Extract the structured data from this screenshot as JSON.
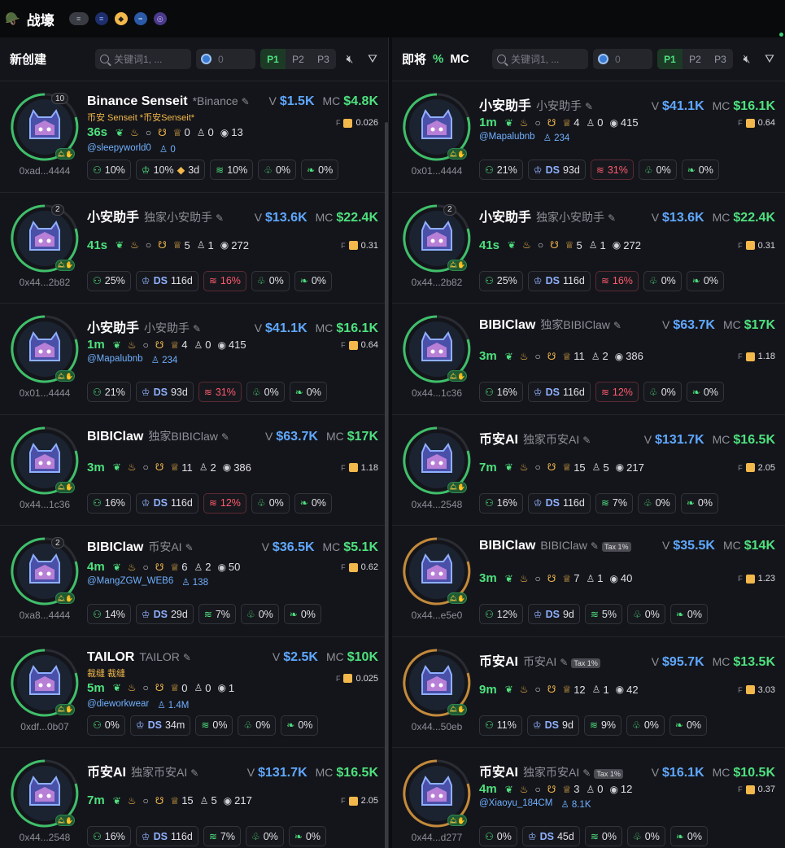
{
  "app": {
    "title": "战壕",
    "logo": "helmet-icon"
  },
  "colors": {
    "accent": "#4ee17f",
    "blue": "#5fa8ff",
    "red": "#ff5b6e",
    "gold": "#f2b84b"
  },
  "left": {
    "title": "新创建",
    "search_placeholder": "关键词1, ...",
    "amount": "0",
    "tabs": [
      "P1",
      "P2",
      "P3"
    ],
    "active_tab": "P1",
    "cards": [
      {
        "name": "Binance Senseit",
        "sub": "*Binance",
        "cn": "币安 Senseit *币安Senseit*",
        "v": "$1.5K",
        "mc": "$4.8K",
        "age": "36s",
        "s1": "0",
        "s2": "0",
        "s3": "13",
        "f": "0.026",
        "handle": "@sleepyworld0",
        "followers": "0",
        "addr": "0xad...4444",
        "cnt": "10",
        "c1": "10%",
        "c2": "10%",
        "c2b": "3d",
        "c3": "10%",
        "c4": "0%",
        "c5": "0%"
      },
      {
        "name": "小安助手",
        "sub": "独家小安助手",
        "v": "$13.6K",
        "mc": "$22.4K",
        "age": "41s",
        "s1": "5",
        "s2": "1",
        "s3": "272",
        "f": "0.31",
        "addr": "0x44...2b82",
        "cnt": "2",
        "c1": "25%",
        "c2": "116d",
        "c3": "16%",
        "c4": "0%",
        "c5": "0%"
      },
      {
        "name": "小安助手",
        "sub": "小安助手",
        "v": "$41.1K",
        "mc": "$16.1K",
        "age": "1m",
        "s1": "4",
        "s2": "0",
        "s3": "415",
        "f": "0.64",
        "handle": "@Mapalubnb",
        "followers": "234",
        "addr": "0x01...4444",
        "c1": "21%",
        "c2": "93d",
        "c3": "31%",
        "c4": "0%",
        "c5": "0%"
      },
      {
        "name": "BIBIClaw",
        "sub": "独家BIBIClaw",
        "v": "$63.7K",
        "mc": "$17K",
        "age": "3m",
        "s1": "11",
        "s2": "2",
        "s3": "386",
        "f": "1.18",
        "addr": "0x44...1c36",
        "c1": "16%",
        "c2": "116d",
        "c3": "12%",
        "c4": "0%",
        "c5": "0%"
      },
      {
        "name": "BIBIClaw",
        "sub": "币安AI",
        "v": "$36.5K",
        "mc": "$5.1K",
        "age": "4m",
        "s1": "6",
        "s2": "2",
        "s3": "50",
        "f": "0.62",
        "handle": "@MangZGW_WEB6",
        "followers": "138",
        "addr": "0xa8...4444",
        "cnt": "2",
        "c1": "14%",
        "c2": "29d",
        "c3": "7%",
        "c4": "0%",
        "c5": "0%"
      },
      {
        "name": "TAILOR",
        "sub": "TAILOR",
        "cn": "裁缝 裁缝",
        "v": "$2.5K",
        "mc": "$10K",
        "age": "5m",
        "s1": "0",
        "s2": "0",
        "s3": "1",
        "f": "0.025",
        "handle": "@dieworkwear",
        "followers": "1.4M",
        "addr": "0xdf...0b07",
        "c1": "0%",
        "c2": "34m",
        "c3": "0%",
        "c4": "0%",
        "c5": "0%"
      },
      {
        "name": "币安AI",
        "sub": "独家币安AI",
        "v": "$131.7K",
        "mc": "$16.5K",
        "age": "7m",
        "s1": "15",
        "s2": "5",
        "s3": "217",
        "f": "2.05",
        "addr": "0x44...2548",
        "c1": "16%",
        "c2": "116d",
        "c3": "7%",
        "c4": "0%",
        "c5": "0%"
      }
    ]
  },
  "right": {
    "title": "即将",
    "pct": "%",
    "mc": "MC",
    "search_placeholder": "关键词1, ...",
    "amount": "0",
    "tabs": [
      "P1",
      "P2",
      "P3"
    ],
    "active_tab": "P1",
    "cards": [
      {
        "name": "小安助手",
        "sub": "小安助手",
        "v": "$41.1K",
        "mc": "$16.1K",
        "age": "1m",
        "s1": "4",
        "s2": "0",
        "s3": "415",
        "f": "0.64",
        "handle": "@Mapalubnb",
        "followers": "234",
        "addr": "0x01...4444",
        "c1": "21%",
        "c2": "93d",
        "c3": "31%",
        "c4": "0%",
        "c5": "0%"
      },
      {
        "name": "小安助手",
        "sub": "独家小安助手",
        "v": "$13.6K",
        "mc": "$22.4K",
        "age": "41s",
        "s1": "5",
        "s2": "1",
        "s3": "272",
        "f": "0.31",
        "addr": "0x44...2b82",
        "cnt": "2",
        "c1": "25%",
        "c2": "116d",
        "c3": "16%",
        "c4": "0%",
        "c5": "0%"
      },
      {
        "name": "BIBIClaw",
        "sub": "独家BIBIClaw",
        "v": "$63.7K",
        "mc": "$17K",
        "age": "3m",
        "s1": "11",
        "s2": "2",
        "s3": "386",
        "f": "1.18",
        "addr": "0x44...1c36",
        "c1": "16%",
        "c2": "116d",
        "c3": "12%",
        "c4": "0%",
        "c5": "0%"
      },
      {
        "name": "币安AI",
        "sub": "独家币安AI",
        "v": "$131.7K",
        "mc": "$16.5K",
        "age": "7m",
        "s1": "15",
        "s2": "5",
        "s3": "217",
        "f": "2.05",
        "addr": "0x44...2548",
        "c1": "16%",
        "c2": "116d",
        "c3": "7%",
        "c4": "0%",
        "c5": "0%"
      },
      {
        "name": "BIBIClaw",
        "sub": "BIBIClaw",
        "tax": "Tax 1%",
        "v": "$35.5K",
        "mc": "$14K",
        "age": "3m",
        "s1": "7",
        "s2": "1",
        "s3": "40",
        "f": "1.23",
        "addr": "0x44...e5e0",
        "c1": "12%",
        "c2": "9d",
        "c3": "5%",
        "c4": "0%",
        "c5": "0%"
      },
      {
        "name": "币安AI",
        "sub": "币安AI",
        "tax": "Tax 1%",
        "v": "$95.7K",
        "mc": "$13.5K",
        "age": "9m",
        "s1": "12",
        "s2": "1",
        "s3": "42",
        "f": "3.03",
        "addr": "0x44...50eb",
        "c1": "11%",
        "c2": "9d",
        "c3": "9%",
        "c4": "0%",
        "c5": "0%"
      },
      {
        "name": "币安AI",
        "sub": "独家币安AI",
        "tax": "Tax 1%",
        "v": "$16.1K",
        "mc": "$10.5K",
        "age": "4m",
        "s1": "3",
        "s2": "0",
        "s3": "12",
        "f": "0.37",
        "handle": "@Xiaoyu_184CM",
        "followers": "8.1K",
        "addr": "0x44...d277",
        "c1": "0%",
        "c2": "45d",
        "c3": "0%",
        "c4": "0%",
        "c5": "0%"
      }
    ]
  },
  "labels": {
    "v": "V",
    "mc": "MC",
    "f": "F",
    "ds": "DS"
  }
}
